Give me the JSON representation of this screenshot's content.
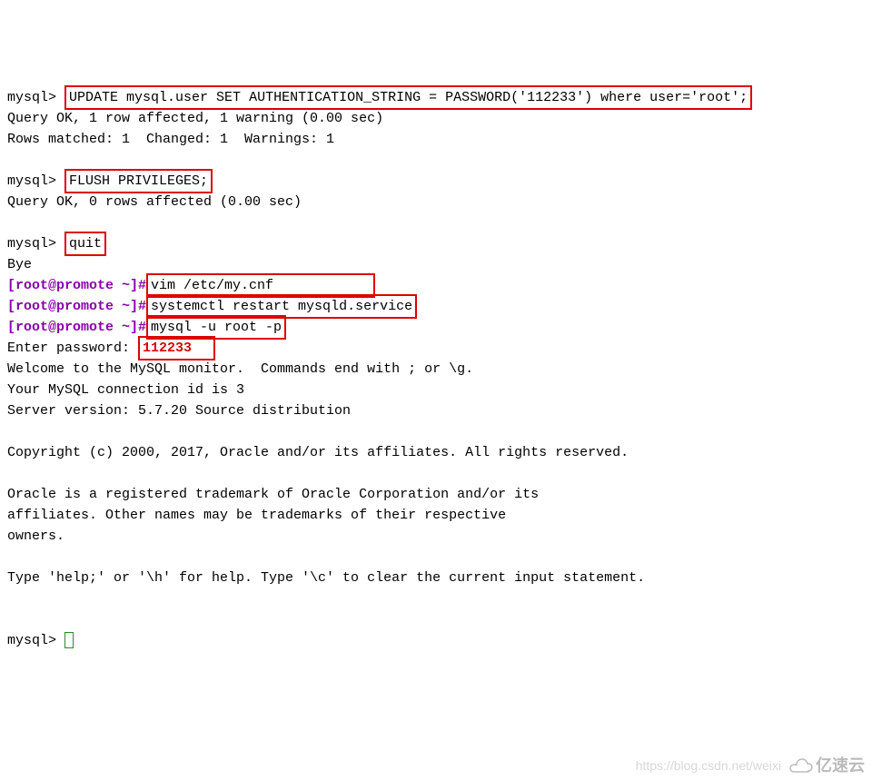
{
  "prompts": {
    "mysql": "mysql>",
    "shell": "[root@promote ~]#"
  },
  "cmds": {
    "update": "UPDATE mysql.user SET AUTHENTICATION_STRING = PASSWORD('112233') where user='root';",
    "flush": "FLUSH PRIVILEGES;",
    "quit": "quit",
    "vim": "vim /etc/my.cnf",
    "systemctl": "systemctl restart mysqld.service",
    "mysqlLogin": "mysql -u root -p"
  },
  "outputs": {
    "queryOk1": "Query OK, 1 row affected, 1 warning (0.00 sec)",
    "rowsMatched": "Rows matched: 1  Changed: 1  Warnings: 1",
    "queryOk2": "Query OK, 0 rows affected (0.00 sec)",
    "bye": "Bye",
    "enterPassword": "Enter password:",
    "password": "112233",
    "welcome1": "Welcome to the MySQL monitor.  Commands end with ; or \\g.",
    "welcome2": "Your MySQL connection id is 3",
    "welcome3": "Server version: 5.7.20 Source distribution",
    "copyright": "Copyright (c) 2000, 2017, Oracle and/or its affiliates. All rights reserved.",
    "trademark1": "Oracle is a registered trademark of Oracle Corporation and/or its",
    "trademark2": "affiliates. Other names may be trademarks of their respective",
    "trademark3": "owners.",
    "help": "Type 'help;' or '\\h' for help. Type '\\c' to clear the current input statement."
  },
  "watermark": {
    "text": "https://blog.csdn.net/weixi",
    "logo": "亿速云"
  }
}
